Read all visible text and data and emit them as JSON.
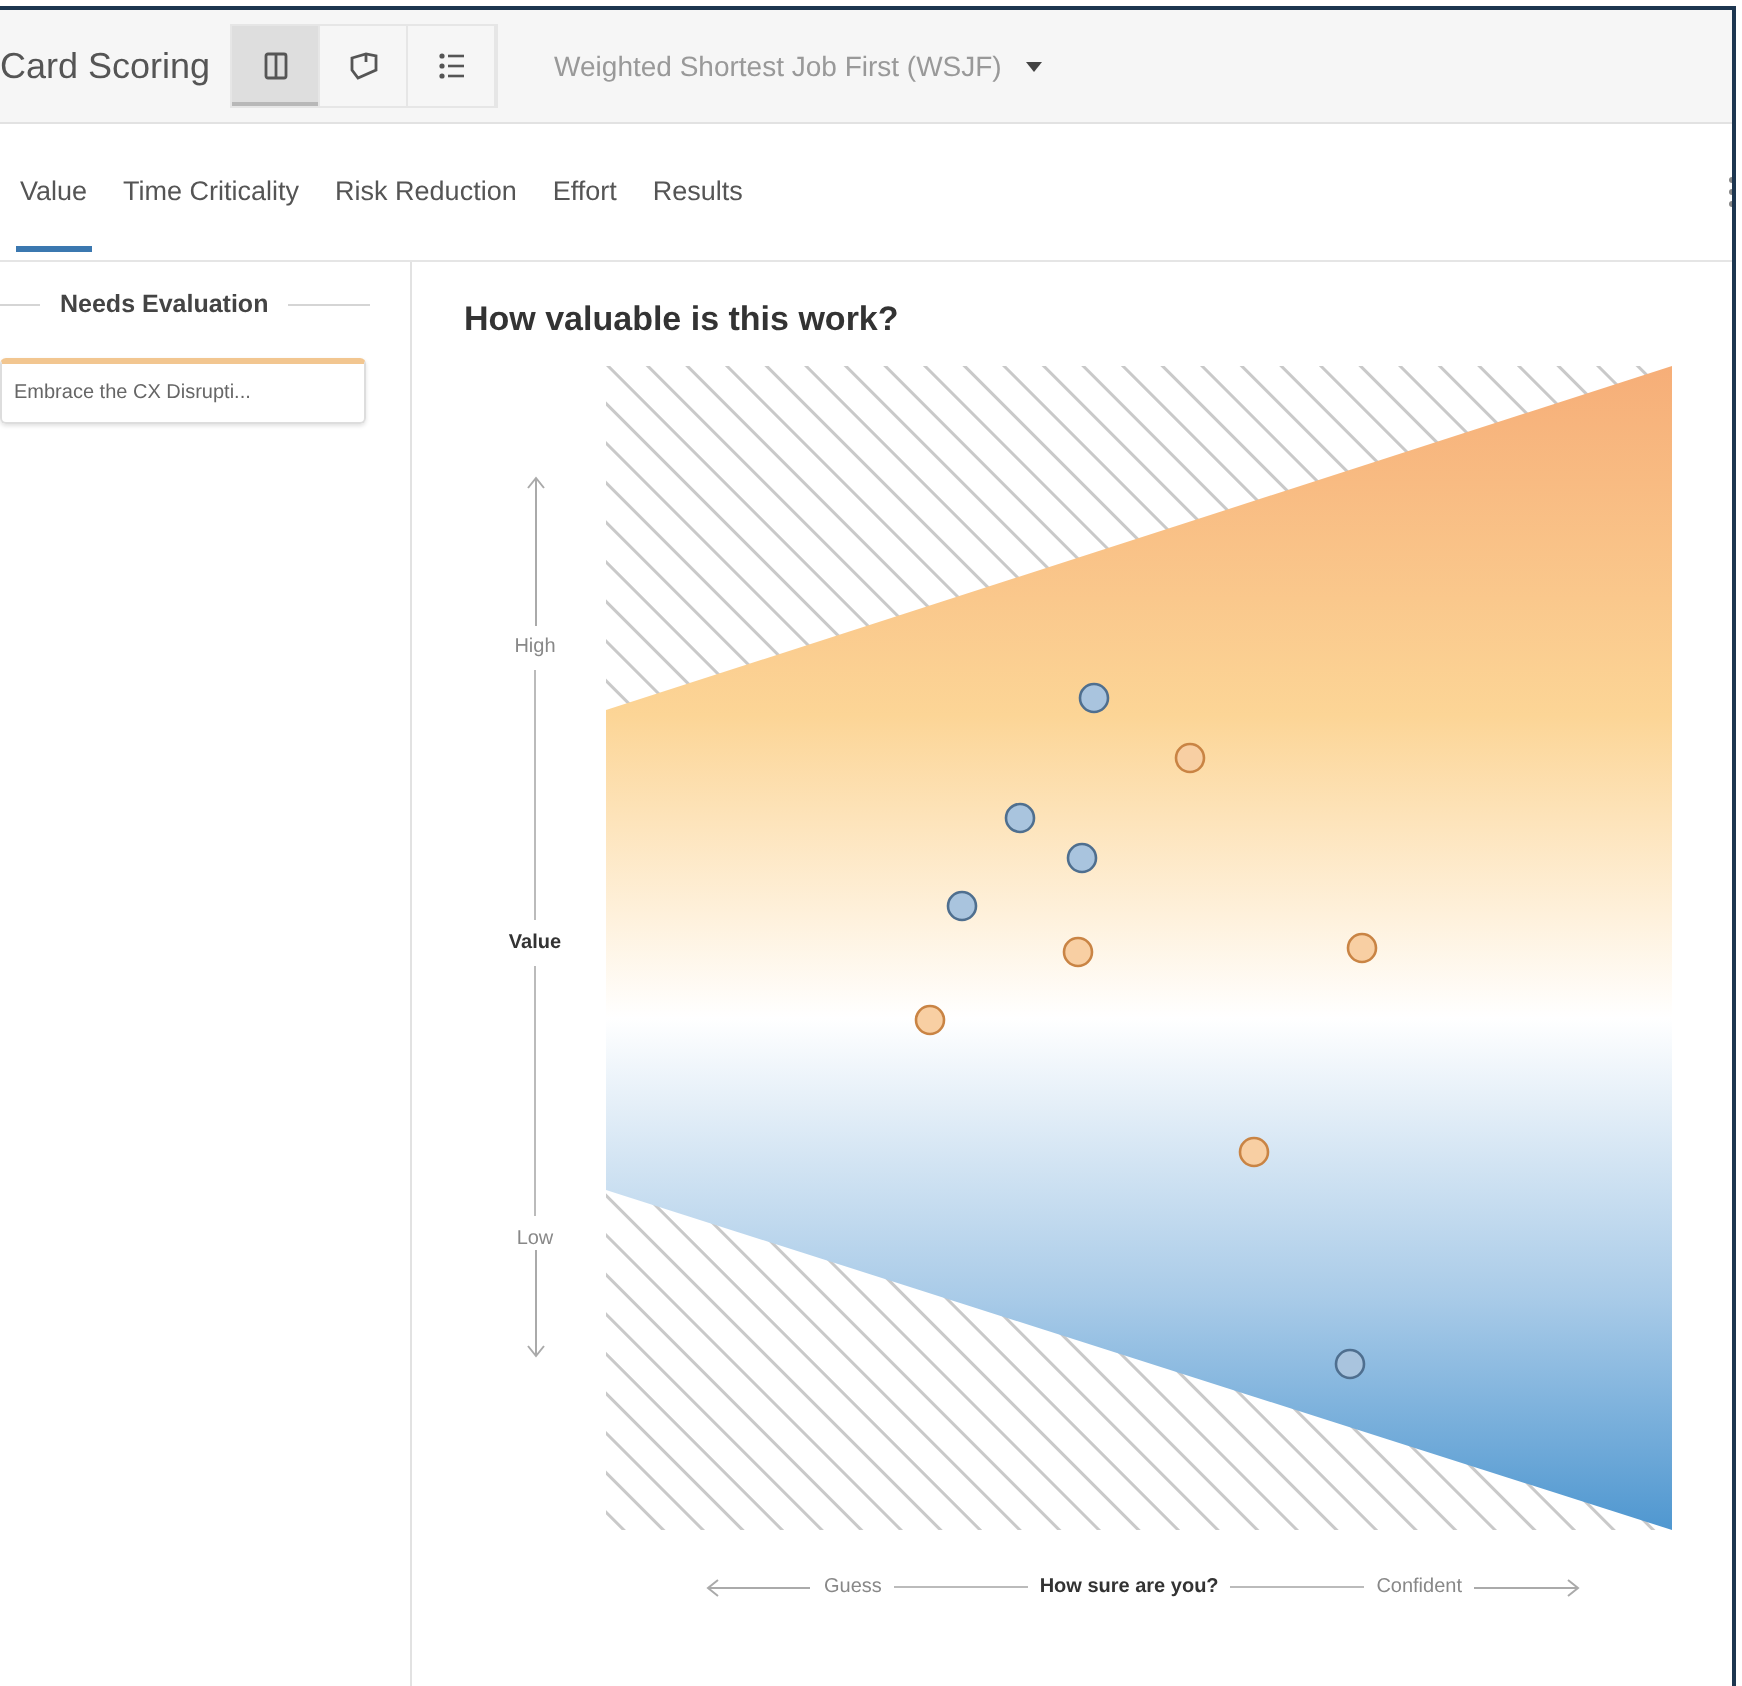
{
  "toolbar": {
    "title": "Card Scoring",
    "view_buttons": [
      {
        "kind": "board",
        "selected": true
      },
      {
        "kind": "tag",
        "selected": false
      },
      {
        "kind": "list",
        "selected": false
      }
    ],
    "method_dropdown": {
      "value": "Weighted Shortest Job First (WSJF)"
    }
  },
  "tabs": [
    {
      "label": "Value",
      "selected": true
    },
    {
      "label": "Time Criticality",
      "selected": false
    },
    {
      "label": "Risk Reduction",
      "selected": false
    },
    {
      "label": "Effort",
      "selected": false
    },
    {
      "label": "Results",
      "selected": false
    }
  ],
  "sidebar": {
    "header": "Needs Evaluation",
    "cards": [
      {
        "title": "Embrace the CX Disrupti..."
      }
    ]
  },
  "main": {
    "title": "How valuable is this work?",
    "y_axis": {
      "high": "High",
      "label": "Value",
      "low": "Low"
    },
    "x_axis": {
      "low": "Guess",
      "label": "How sure are you?",
      "high": "Confident"
    }
  }
}
